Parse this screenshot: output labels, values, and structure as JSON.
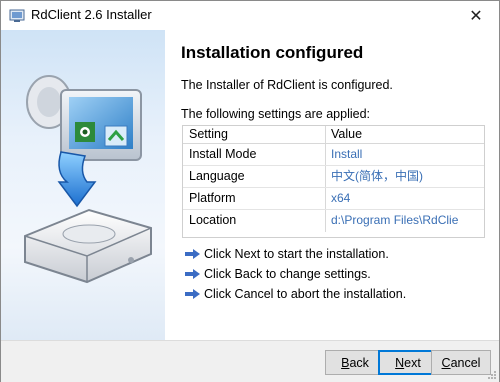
{
  "window": {
    "title": "RdClient 2.6 Installer",
    "close_glyph": "✕"
  },
  "main": {
    "heading": "Installation configured",
    "configured_text": "The Installer of RdClient is configured.",
    "settings_intro": "The following settings are applied:"
  },
  "settings_table": {
    "headers": {
      "setting": "Setting",
      "value": "Value"
    },
    "rows": [
      {
        "setting": "Install Mode",
        "value": "Install"
      },
      {
        "setting": "Language",
        "value": "中文(简体，中国)"
      },
      {
        "setting": "Platform",
        "value": "x64"
      },
      {
        "setting": "Location",
        "value": "d:\\Program Files\\RdClie"
      }
    ]
  },
  "instructions": [
    {
      "icon": "arrow-right-icon",
      "text": "Click Next to start the installation."
    },
    {
      "icon": "arrow-right-icon",
      "text": "Click Back to change settings."
    },
    {
      "icon": "arrow-right-icon",
      "text": "Click Cancel to abort the installation."
    }
  ],
  "buttons": {
    "back": {
      "accel": "B",
      "rest": "ack"
    },
    "next": {
      "accel": "N",
      "rest": "ext"
    },
    "cancel": {
      "accel": "C",
      "rest": "ancel"
    }
  },
  "colors": {
    "accent": "#0078d7",
    "value_text": "#3a6fb5",
    "footer_bg": "#f0f0f0",
    "arrow": "#3b6cc4"
  }
}
